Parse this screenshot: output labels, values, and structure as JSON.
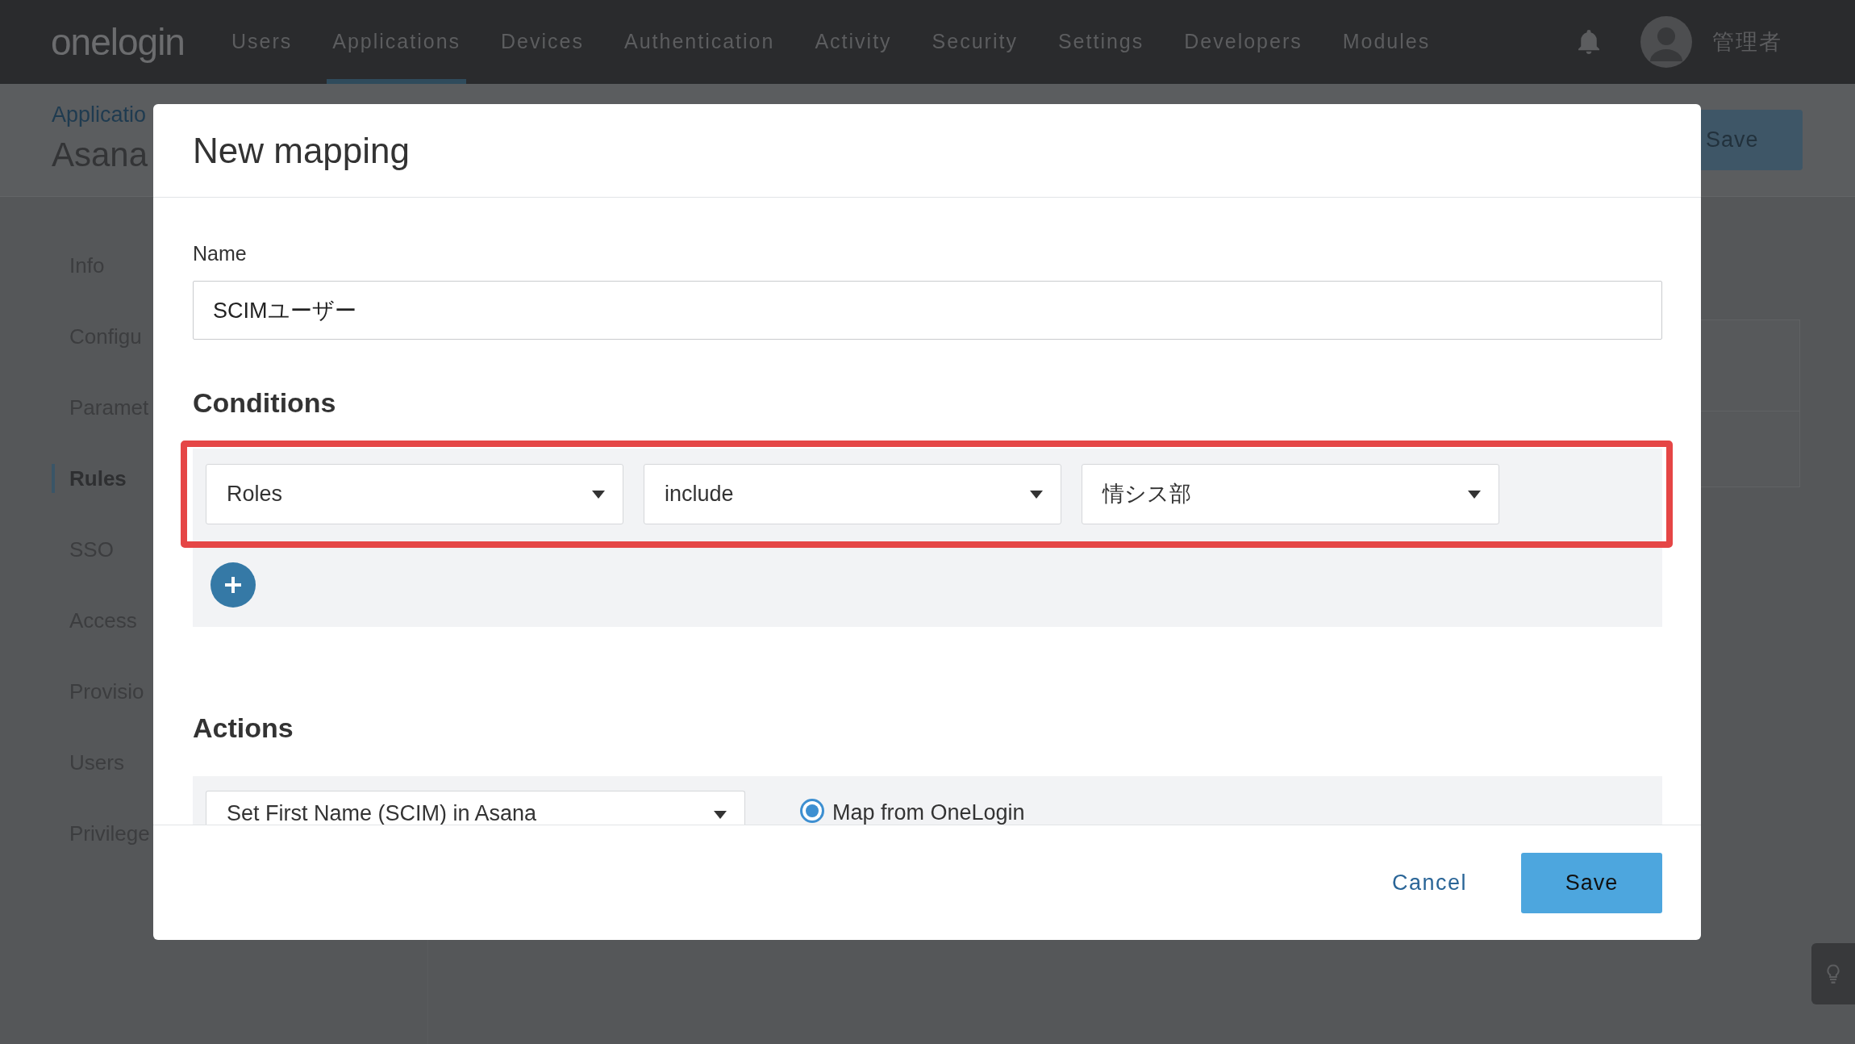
{
  "top_nav": {
    "logo": "onelogin",
    "items": [
      {
        "label": "Users",
        "selected": false
      },
      {
        "label": "Applications",
        "selected": true
      },
      {
        "label": "Devices",
        "selected": false
      },
      {
        "label": "Authentication",
        "selected": false
      },
      {
        "label": "Activity",
        "selected": false
      },
      {
        "label": "Security",
        "selected": false
      },
      {
        "label": "Settings",
        "selected": false
      },
      {
        "label": "Developers",
        "selected": false
      },
      {
        "label": "Modules",
        "selected": false
      }
    ],
    "user_name": "管理者"
  },
  "page_header": {
    "breadcrumb": "Applicatio",
    "title": "Asana",
    "save_button": "Save"
  },
  "sidebar": {
    "items": [
      {
        "label": "Info",
        "selected": false
      },
      {
        "label": "Configu",
        "selected": false
      },
      {
        "label": "Paramet",
        "selected": false
      },
      {
        "label": "Rules",
        "selected": true
      },
      {
        "label": "SSO",
        "selected": false
      },
      {
        "label": "Access",
        "selected": false
      },
      {
        "label": "Provisio",
        "selected": false
      },
      {
        "label": "Users",
        "selected": false
      },
      {
        "label": "Privilege",
        "selected": false
      }
    ]
  },
  "dialog": {
    "title": "New mapping",
    "name_field": {
      "label": "Name",
      "value": "SCIMユーザー"
    },
    "conditions": {
      "heading": "Conditions",
      "highlighted": true,
      "rows": [
        {
          "selects": [
            "Roles",
            "include",
            "情シス部"
          ]
        }
      ]
    },
    "actions": {
      "heading": "Actions",
      "rows": [
        {
          "select": "Set First Name (SCIM) in Asana",
          "options": [
            {
              "label": "Map from OneLogin",
              "selected": true
            }
          ]
        }
      ]
    },
    "cancel_button": "Cancel",
    "save_button": "Save"
  }
}
